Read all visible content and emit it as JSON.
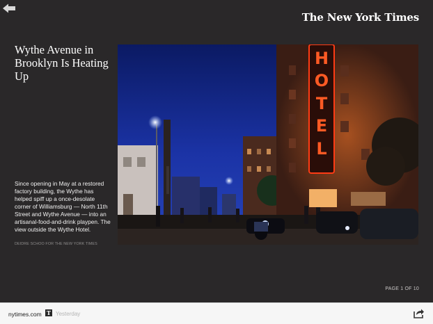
{
  "header": {
    "logo_text": "The New York Times",
    "back_icon": "back-arrow-icon"
  },
  "article": {
    "headline": "Wythe Avenue in Brooklyn Is Heating Up",
    "caption": "Since opening in May at a restored factory building, the Wythe has helped spiff up a once-desolate corner of Williamsburg — North 11th Street and Wythe Avenue — into an artisanal-food-and-drink playpen. The view outside the Wythe Hotel.",
    "credit": "DEIDRE SCHOO FOR THE NEW YORK TIMES",
    "sign_text": "HOTEL"
  },
  "pagination": {
    "label": "PAGE 1 OF 10"
  },
  "footer": {
    "site": "nytimes.com",
    "badge": "T",
    "timestamp": "Yesterday",
    "share_icon": "share-icon"
  },
  "colors": {
    "background": "#2a2829",
    "footer_background": "#f6f6f6",
    "neon_red": "#ff3b14"
  }
}
